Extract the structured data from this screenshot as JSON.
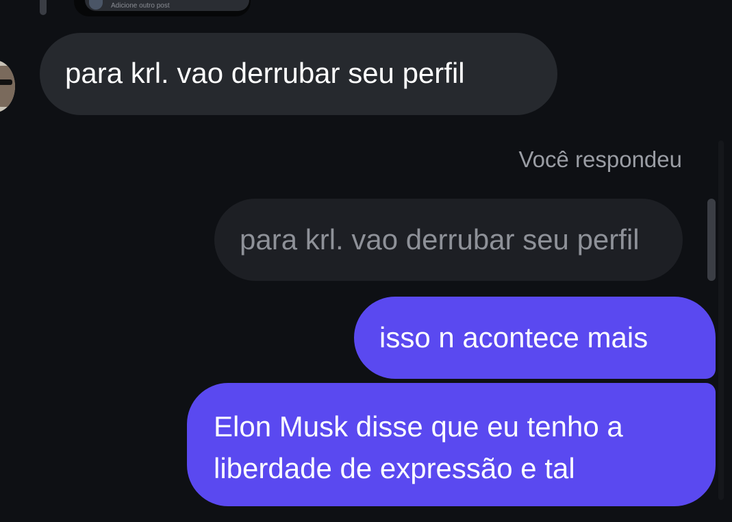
{
  "previous_post": {
    "text": "Adicione outro post"
  },
  "messages": {
    "received": {
      "text": "para krl. vao derrubar seu perfil"
    },
    "reply_label": "Você respondeu",
    "quoted": {
      "text": "para krl. vao derrubar seu perfil"
    },
    "sent": [
      {
        "text": "isso n acontece mais"
      },
      {
        "text": "Elon Musk disse que eu tenho a liberdade de expressão e tal"
      }
    ]
  },
  "colors": {
    "background": "#0e1014",
    "received_bubble": "#26292e",
    "quoted_bubble": "#1d1f24",
    "sent_bubble": "#5a49f0"
  }
}
